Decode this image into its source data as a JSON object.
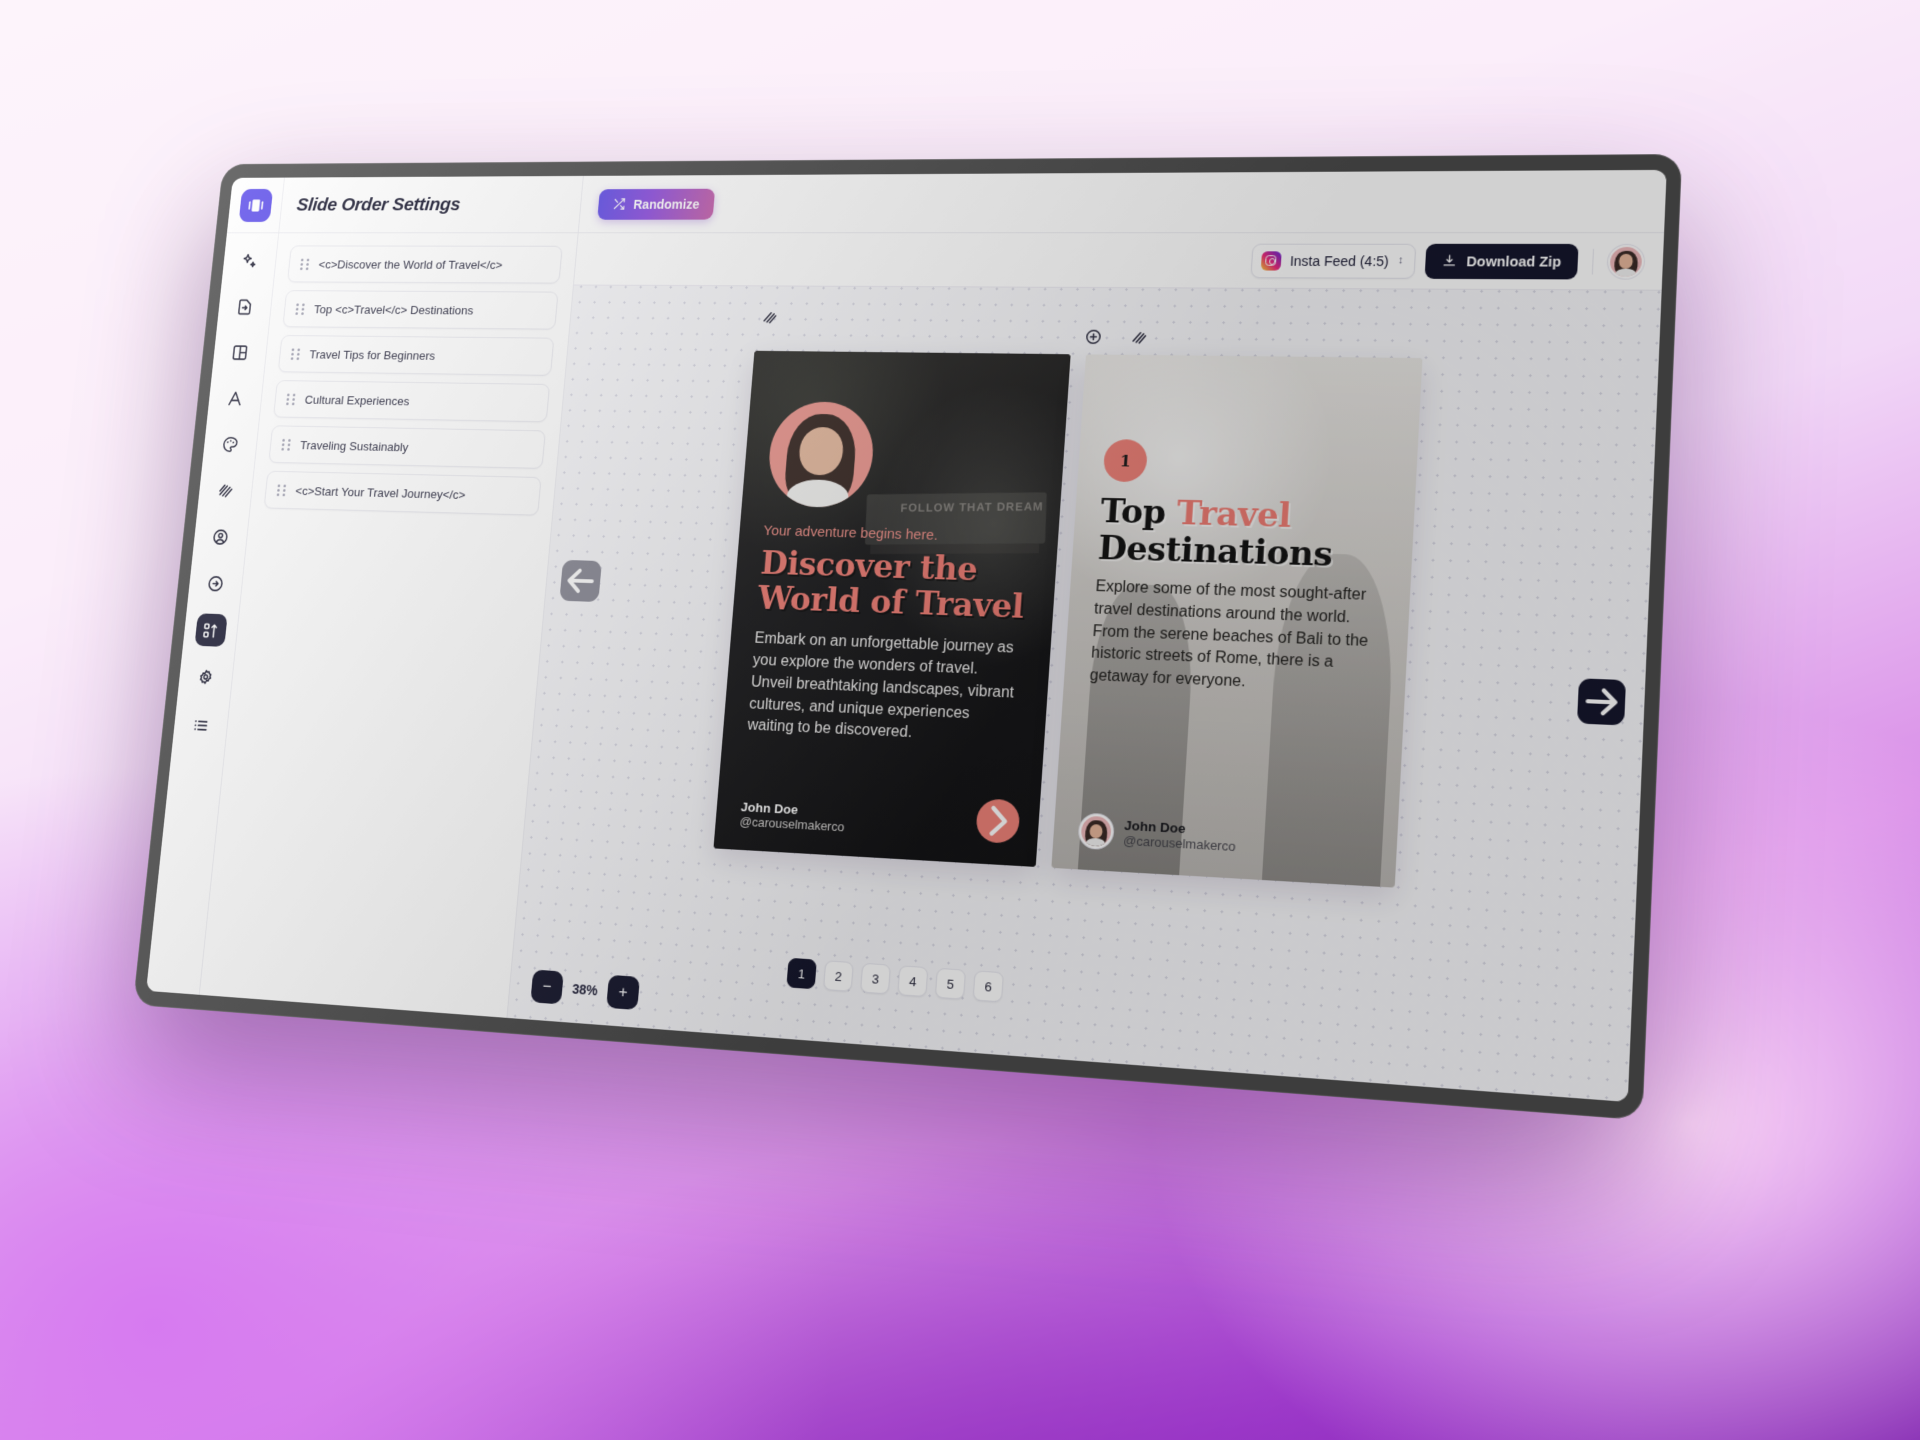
{
  "app": {
    "logo_icon": "carousel-logo-icon",
    "panel_title": "Slide Order Settings"
  },
  "toolbar": {
    "randomize_label": "Randomize",
    "randomize_icon": "shuffle-icon"
  },
  "sidebar_rail": [
    {
      "name": "magic",
      "icon": "sparkles-icon",
      "active": false
    },
    {
      "name": "import",
      "icon": "file-export-icon",
      "active": false
    },
    {
      "name": "layout",
      "icon": "layout-icon",
      "active": false
    },
    {
      "name": "text",
      "icon": "text-a-icon",
      "active": false
    },
    {
      "name": "colors",
      "icon": "palette-icon",
      "active": false
    },
    {
      "name": "pattern",
      "icon": "stripes-icon",
      "active": false
    },
    {
      "name": "profile",
      "icon": "user-circle-icon",
      "active": false
    },
    {
      "name": "cta",
      "icon": "arrow-circle-right-icon",
      "active": false
    },
    {
      "name": "slide-order",
      "icon": "sort-icon",
      "active": true
    },
    {
      "name": "settings",
      "icon": "gear-icon",
      "active": false
    },
    {
      "name": "list",
      "icon": "list-icon",
      "active": false
    }
  ],
  "slide_order": {
    "items": [
      {
        "label": "<c>Discover the World of Travel</c>"
      },
      {
        "label": "Top <c>Travel</c> Destinations"
      },
      {
        "label": "Travel Tips for Beginners"
      },
      {
        "label": "Cultural Experiences"
      },
      {
        "label": "Traveling Sustainably"
      },
      {
        "label": "<c>Start Your Travel Journey</c>"
      }
    ]
  },
  "canvas_header": {
    "ratio_label": "Insta Feed (4:5)",
    "ratio_icon": "instagram-icon",
    "chevron_icon": "chevron-updown-icon",
    "download_label": "Download Zip",
    "download_icon": "download-icon",
    "avatar": "user-avatar"
  },
  "stage": {
    "prev_icon": "arrow-left-icon",
    "next_icon": "arrow-right-icon",
    "mini_icons": [
      "stripes-icon",
      "add-slide-icon",
      "stripes-icon"
    ]
  },
  "slides": {
    "slide1": {
      "kicker": "Your adventure begins here.",
      "title": "Discover the World of Travel",
      "body": "Embark on an unforgettable journey as you explore the wonders of travel. Unveil breathtaking landscapes, vibrant cultures, and unique experiences waiting to be discovered.",
      "author_name": "John Doe",
      "author_handle": "@carouselmakerco",
      "sign_text": "FOLLOW THAT DREAM",
      "next_icon": "chevron-right-icon"
    },
    "slide2": {
      "number": "1",
      "title_part1": "Top ",
      "title_highlight": "Travel",
      "title_part2": "Destinations",
      "body": "Explore some of the most sought-after travel destinations around the world. From the serene beaches of Bali to the historic streets of Rome, there is a getaway for everyone.",
      "author_name": "John Doe",
      "author_handle": "@carouselmakerco"
    }
  },
  "pager": {
    "pages": [
      "1",
      "2",
      "3",
      "4",
      "5",
      "6"
    ],
    "current": "1"
  },
  "zoom": {
    "minus_label": "−",
    "value": "38%",
    "plus_label": "+"
  },
  "colors": {
    "accent_purple": "#5a4bea",
    "accent_pink": "#ef7d74",
    "dark": "#15162c",
    "gradient_from": "#5b4ae6",
    "gradient_to": "#c45ea8"
  }
}
